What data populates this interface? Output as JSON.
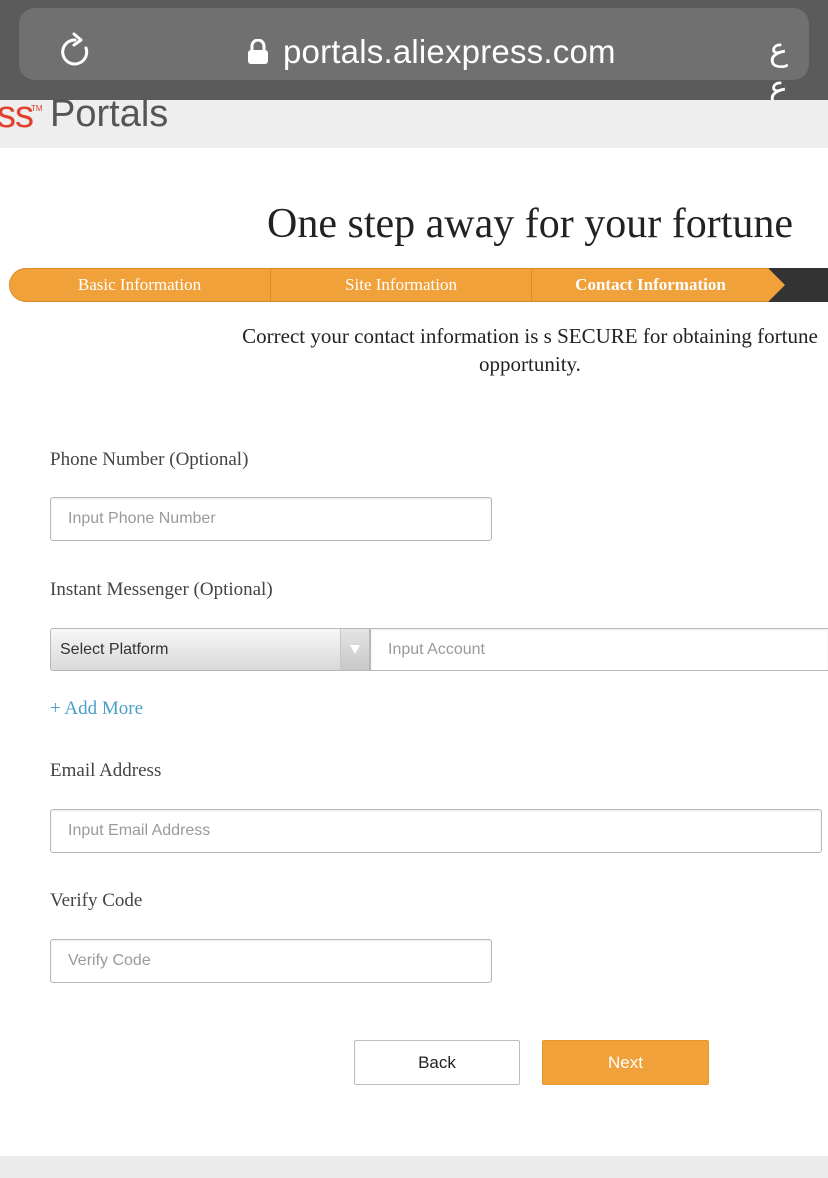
{
  "browser": {
    "url": "portals.aliexpress.com",
    "reader_label": "ع ع",
    "icons": {
      "reload": "reload-icon",
      "lock": "lock-icon"
    }
  },
  "header": {
    "logo_partial": "ss",
    "logo_tm": "TM",
    "portals": "Portals"
  },
  "page_title": "One step away for your fortune",
  "steps": [
    {
      "label": "Basic Information"
    },
    {
      "label": "Site Information"
    },
    {
      "label": "Contact Information",
      "active": true
    }
  ],
  "intro": "Correct your contact information is s SECURE for obtaining fortune opportunity.",
  "form": {
    "phone": {
      "label": "Phone Number (Optional)",
      "placeholder": "Input Phone Number",
      "value": ""
    },
    "messenger": {
      "label": "Instant Messenger (Optional)",
      "platform_selected": "Select Platform",
      "account_placeholder": "Input Account",
      "account_value": ""
    },
    "add_more": "+ Add More",
    "email": {
      "label": "Email Address",
      "placeholder": "Input Email Address",
      "value": ""
    },
    "verify": {
      "label": "Verify Code",
      "placeholder": "Verify Code",
      "value": ""
    }
  },
  "buttons": {
    "back": "Back",
    "next": "Next"
  },
  "colors": {
    "accent": "#f0a13a",
    "link": "#4a9fc9",
    "logo_red": "#e0402c",
    "browser_bar": "#5b5b5b"
  }
}
